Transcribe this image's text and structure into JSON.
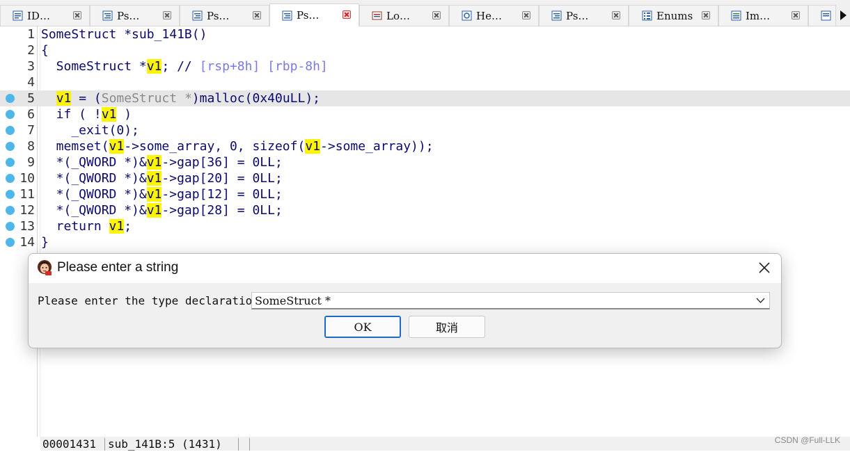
{
  "tabs": [
    {
      "label": "ID…",
      "icon": "ida-view-icon",
      "active": false
    },
    {
      "label": "Ps…",
      "icon": "pseudocode-icon",
      "active": false
    },
    {
      "label": "Ps…",
      "icon": "pseudocode-icon",
      "active": false
    },
    {
      "label": "Ps…",
      "icon": "pseudocode-icon",
      "active": true
    },
    {
      "label": "Lo…",
      "icon": "locals-icon",
      "active": false
    },
    {
      "label": "He…",
      "icon": "hex-view-icon",
      "active": false
    },
    {
      "label": "Ps…",
      "icon": "pseudocode-icon",
      "active": false
    },
    {
      "label": "Enums",
      "icon": "enums-icon",
      "active": false
    },
    {
      "label": "Im…",
      "icon": "imports-icon",
      "active": false
    }
  ],
  "code": {
    "line_numbers": [
      "1",
      "2",
      "3",
      "4",
      "5",
      "6",
      "7",
      "8",
      "9",
      "10",
      "11",
      "12",
      "13",
      "14"
    ],
    "lines": {
      "l1": "SomeStruct *sub_141B()",
      "l2": "{",
      "l3_a": "  SomeStruct *",
      "l3_v": "v1",
      "l3_b": "; // ",
      "l3_c": "[rsp+8h] [rbp-8h]",
      "l5_v": "v1",
      "l5_a": " = (",
      "l5_cast": "SomeStruct *",
      "l5_b": ")malloc(0x40uLL);",
      "l6_a": "  if ( !",
      "l6_v": "v1",
      "l6_b": " )",
      "l7": "    _exit(0);",
      "l8_a": "  memset(",
      "l8_v1": "v1",
      "l8_b": "->some_array, 0, sizeof(",
      "l8_v2": "v1",
      "l8_c": "->some_array));",
      "l9_a": "  *(_QWORD *)&",
      "l9_v": "v1",
      "l9_b": "->gap[36] = 0LL;",
      "l10_a": "  *(_QWORD *)&",
      "l10_v": "v1",
      "l10_b": "->gap[20] = 0LL;",
      "l11_a": "  *(_QWORD *)&",
      "l11_v": "v1",
      "l11_b": "->gap[12] = 0LL;",
      "l12_a": "  *(_QWORD *)&",
      "l12_v": "v1",
      "l12_b": "->gap[28] = 0LL;",
      "l13_a": "  return ",
      "l13_v": "v1",
      "l13_b": ";",
      "l14": "}"
    },
    "current_line": "5",
    "breakpoint_lines": [
      "5",
      "6",
      "7",
      "8",
      "9",
      "10",
      "11",
      "12",
      "13",
      "14"
    ]
  },
  "status": {
    "address": "00001431",
    "location": "sub_141B:5 (1431)"
  },
  "watermark": "CSDN @Full-LLK",
  "dialog": {
    "title": "Please enter a string",
    "label": "Please enter the type declaration",
    "value": "SomeStruct *",
    "ok_label": "OK",
    "cancel_label": "取消"
  },
  "colors": {
    "highlight": "#fff500",
    "code_text": "#0a0a6e",
    "comment": "#7a7ae6",
    "breakpoint": "#4fb6ea",
    "current_line_bg": "#e6e6e6"
  }
}
